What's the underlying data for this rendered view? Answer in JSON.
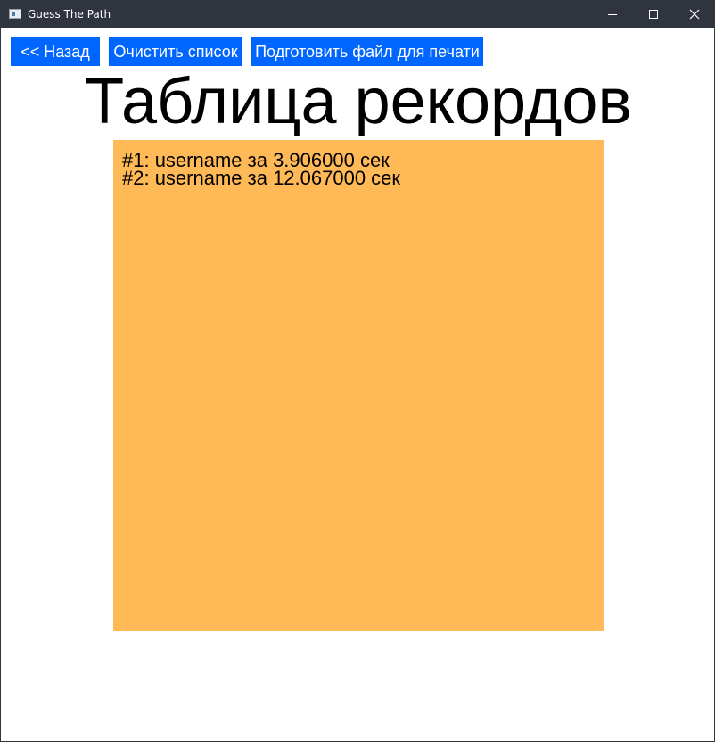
{
  "window": {
    "title": "Guess The Path",
    "app_icon": "app-window-icon",
    "controls": {
      "minimize_icon": "minimize-icon",
      "maximize_icon": "maximize-icon",
      "close_icon": "close-icon"
    }
  },
  "toolbar": {
    "back_label": "<< Назад",
    "clear_label": "Очистить список",
    "print_label": "Подготовить файл для печати"
  },
  "page": {
    "title": "Таблица рекордов"
  },
  "records": [
    "#1: username за 3.906000 сек",
    "#2: username за 12.067000 сек"
  ],
  "colors": {
    "titlebar": "#2f343f",
    "button": "#0066ff",
    "panel": "#ffb957"
  }
}
